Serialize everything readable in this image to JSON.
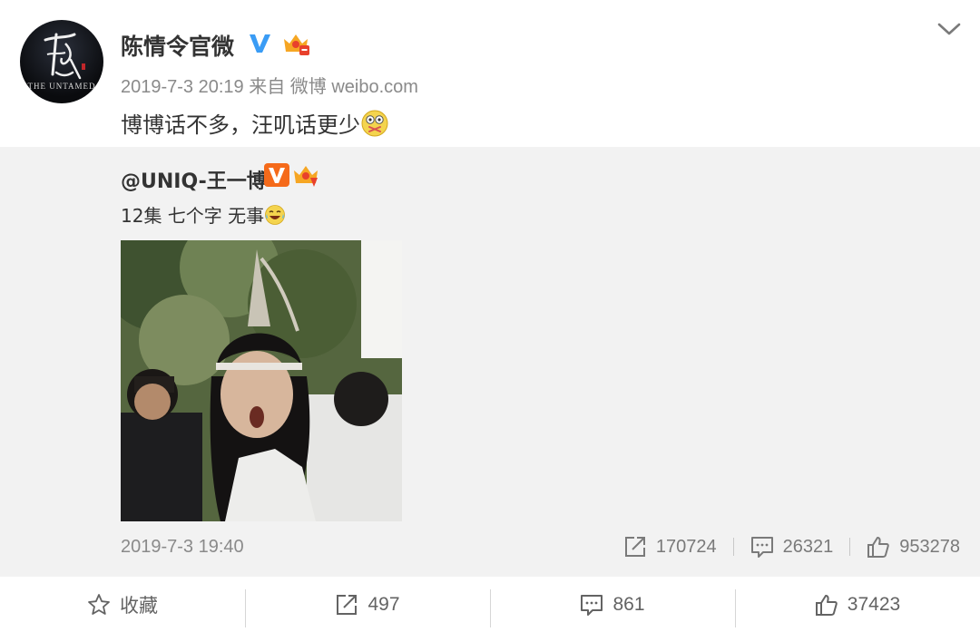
{
  "post": {
    "username": "陈情令官微",
    "timestamp": "2019-7-3 20:19",
    "source": "来自 微博 weibo.com",
    "text": "博博话不多，汪叽话更少",
    "avatar_text": "THE UNTAMED"
  },
  "repost": {
    "original_user": "@UNIQ-王一博",
    "original_text": "12集 七个字 无事",
    "original_time": "2019-7-3 19:40",
    "stats": {
      "reposts": "170724",
      "comments": "26321",
      "likes": "953278"
    }
  },
  "actions": {
    "favorite": "收藏",
    "repost": "497",
    "comment": "861",
    "like": "37423"
  },
  "colors": {
    "verified_blue": "#3a9cf5",
    "verified_orange": "#f56a1a",
    "repost_bg": "#f2f2f2",
    "muted_text": "#8a8a8a"
  }
}
